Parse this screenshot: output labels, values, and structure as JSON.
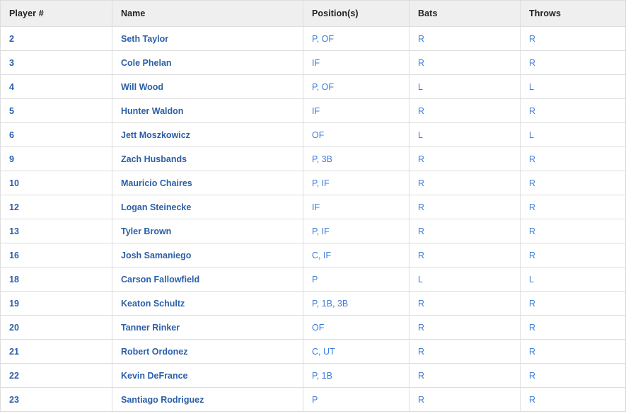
{
  "table": {
    "columns": [
      {
        "key": "number",
        "label": "Player #"
      },
      {
        "key": "name",
        "label": "Name"
      },
      {
        "key": "position",
        "label": "Position(s)"
      },
      {
        "key": "bats",
        "label": "Bats"
      },
      {
        "key": "throws",
        "label": "Throws"
      }
    ],
    "rows": [
      {
        "number": "2",
        "name": "Seth Taylor",
        "position": "P, OF",
        "bats": "R",
        "throws": "R"
      },
      {
        "number": "3",
        "name": "Cole Phelan",
        "position": "IF",
        "bats": "R",
        "throws": "R"
      },
      {
        "number": "4",
        "name": "Will Wood",
        "position": "P, OF",
        "bats": "L",
        "throws": "L"
      },
      {
        "number": "5",
        "name": "Hunter Waldon",
        "position": "IF",
        "bats": "R",
        "throws": "R"
      },
      {
        "number": "6",
        "name": "Jett Moszkowicz",
        "position": "OF",
        "bats": "L",
        "throws": "L"
      },
      {
        "number": "9",
        "name": "Zach Husbands",
        "position": "P, 3B",
        "bats": "R",
        "throws": "R"
      },
      {
        "number": "10",
        "name": "Mauricio Chaires",
        "position": "P, IF",
        "bats": "R",
        "throws": "R"
      },
      {
        "number": "12",
        "name": "Logan Steinecke",
        "position": "IF",
        "bats": "R",
        "throws": "R"
      },
      {
        "number": "13",
        "name": "Tyler Brown",
        "position": "P, IF",
        "bats": "R",
        "throws": "R"
      },
      {
        "number": "16",
        "name": "Josh Samaniego",
        "position": "C, IF",
        "bats": "R",
        "throws": "R"
      },
      {
        "number": "18",
        "name": "Carson Fallowfield",
        "position": "P",
        "bats": "L",
        "throws": "L"
      },
      {
        "number": "19",
        "name": "Keaton Schultz",
        "position": "P, 1B, 3B",
        "bats": "R",
        "throws": "R"
      },
      {
        "number": "20",
        "name": "Tanner Rinker",
        "position": "OF",
        "bats": "R",
        "throws": "R"
      },
      {
        "number": "21",
        "name": "Robert Ordonez",
        "position": "C, UT",
        "bats": "R",
        "throws": "R"
      },
      {
        "number": "22",
        "name": "Kevin DeFrance",
        "position": "P, 1B",
        "bats": "R",
        "throws": "R"
      },
      {
        "number": "23",
        "name": "Santiago Rodriguez",
        "position": "P",
        "bats": "R",
        "throws": "R"
      }
    ]
  },
  "colors": {
    "link": "#2b5fa8",
    "value": "#3b7dd8",
    "header_bg": "#efefef",
    "border": "#dddddd",
    "header_text": "#222222"
  }
}
